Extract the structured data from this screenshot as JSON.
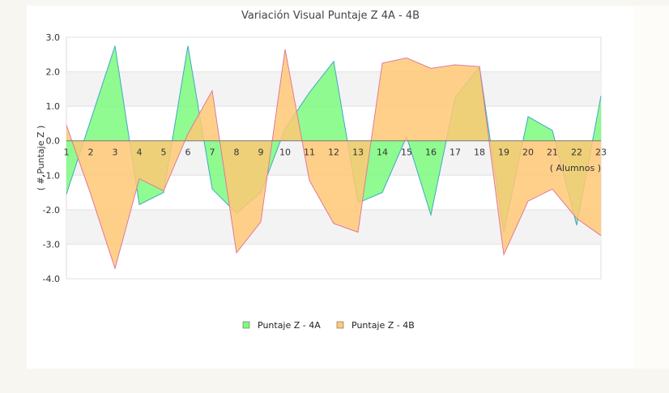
{
  "chart_data": {
    "type": "area",
    "title": "Variación Visual Puntaje Z  4A - 4B",
    "xlabel": "( Alumnos )",
    "ylabel": "( #,Puntaje Z )",
    "ylim": [
      -4.0,
      3.0
    ],
    "yticks": [
      "3.0",
      "2.0",
      "1.0",
      "0.0",
      "-1.0",
      "-2.0",
      "-3.0",
      "-4.0"
    ],
    "categories": [
      "1",
      "2",
      "3",
      "4",
      "5",
      "6",
      "7",
      "8",
      "9",
      "10",
      "11",
      "12",
      "13",
      "14",
      "15",
      "16",
      "17",
      "18",
      "19",
      "20",
      "21",
      "22",
      "23"
    ],
    "grid": true,
    "legend_position": "bottom",
    "series": [
      {
        "name": "Puntaje Z - 4A",
        "color": "#7dfa7d",
        "stroke": "#40a8c8",
        "values": [
          -1.55,
          0.6,
          2.75,
          -1.85,
          -1.5,
          2.75,
          -1.4,
          -2.1,
          -1.5,
          0.35,
          1.4,
          2.3,
          -1.8,
          -1.5,
          0.12,
          -2.15,
          1.25,
          2.15,
          -2.65,
          0.7,
          0.3,
          -2.45,
          1.3
        ]
      },
      {
        "name": "Puntaje Z - 4B",
        "color": "#ffc875",
        "stroke": "#e07a9a",
        "values": [
          0.45,
          -1.55,
          -3.7,
          -1.1,
          -1.45,
          0.2,
          1.45,
          -3.25,
          -2.35,
          2.65,
          -1.15,
          -2.4,
          -2.65,
          2.25,
          2.4,
          2.1,
          2.2,
          2.15,
          -3.3,
          -1.75,
          -1.4,
          -2.25,
          -2.75
        ]
      }
    ]
  }
}
